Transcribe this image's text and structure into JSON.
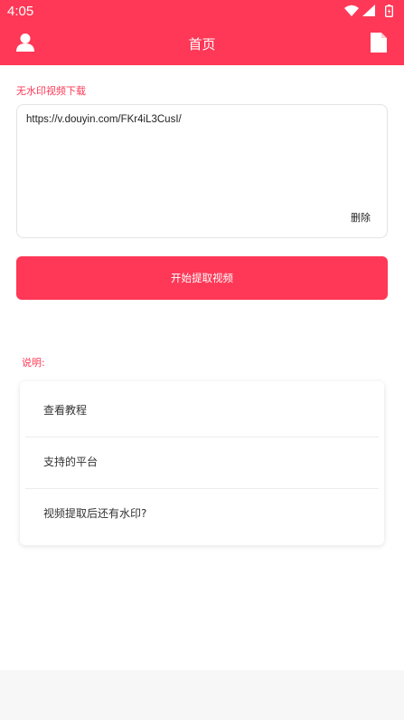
{
  "status_bar": {
    "time": "4:05",
    "icons": [
      "wifi-icon",
      "signal-icon",
      "battery-icon"
    ]
  },
  "header": {
    "title": "首页",
    "left_icon": "user-icon",
    "right_icon": "document-icon"
  },
  "colors": {
    "accent": "#fe3856",
    "background": "#ffffff",
    "bottom_bar": "#f7f7f7"
  },
  "downloader": {
    "section_label": "无水印视频下载",
    "url_value": "https://v.douyin.com/FKr4iL3CusI/",
    "delete_label": "删除",
    "extract_button_label": "开始提取视频"
  },
  "help": {
    "label": "说明:",
    "items": [
      {
        "label": "查看教程"
      },
      {
        "label": "支持的平台"
      },
      {
        "label": "视频提取后还有水印?"
      }
    ]
  }
}
